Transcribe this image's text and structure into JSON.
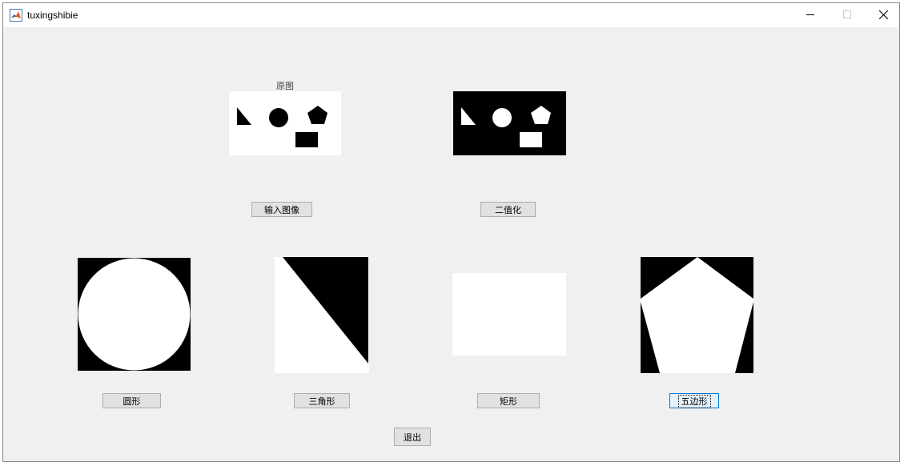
{
  "window": {
    "title": "tuxingshibie",
    "controls": [
      "minimize",
      "maximize",
      "close"
    ]
  },
  "axes": {
    "original_label": "原图"
  },
  "buttons": {
    "input_image": "输入图像",
    "binarize": "二值化",
    "circle": "圆形",
    "triangle": "三角形",
    "rectangle": "矩形",
    "pentagon": "五边形",
    "exit": "退出"
  },
  "colors": {
    "background": "#f0f0f0",
    "button_face": "#e1e1e1",
    "button_border": "#adadad",
    "focus_border": "#0078d7"
  }
}
